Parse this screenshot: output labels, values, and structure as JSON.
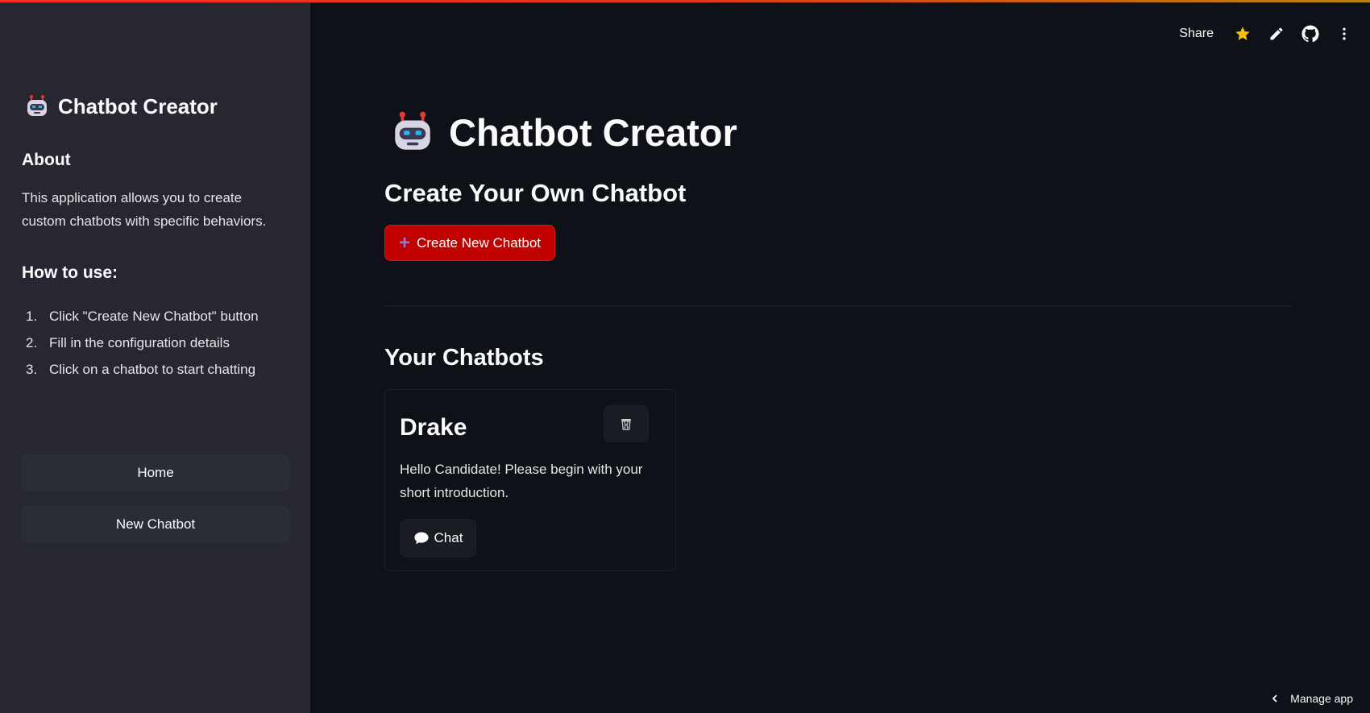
{
  "colors": {
    "background": "#0e1117",
    "sidebar": "#262730",
    "primary_button": "#c10000",
    "accent_star": "#f4c20d"
  },
  "header": {
    "share_label": "Share",
    "icons": [
      "star-icon",
      "pencil-icon",
      "github-icon",
      "more-vertical-icon"
    ]
  },
  "sidebar": {
    "title": "Chatbot Creator",
    "about_heading": "About",
    "about_text": "This application allows you to create custom chatbots with specific behaviors.",
    "howto_heading": "How to use:",
    "steps": [
      {
        "num": "1.",
        "text": "Click \"Create New Chatbot\" button"
      },
      {
        "num": "2.",
        "text": "Fill in the configuration details"
      },
      {
        "num": "3.",
        "text": "Click on a chatbot to start chatting"
      }
    ],
    "nav": {
      "home_label": "Home",
      "new_label": "New Chatbot"
    }
  },
  "main": {
    "title": "Chatbot Creator",
    "create_heading": "Create Your Own Chatbot",
    "create_button_label": "Create New Chatbot",
    "your_heading": "Your Chatbots",
    "chatbots": [
      {
        "name": "Drake",
        "greeting": "Hello Candidate! Please begin with your short introduction.",
        "chat_label": "Chat"
      }
    ]
  },
  "footer": {
    "manage_label": "Manage app"
  }
}
